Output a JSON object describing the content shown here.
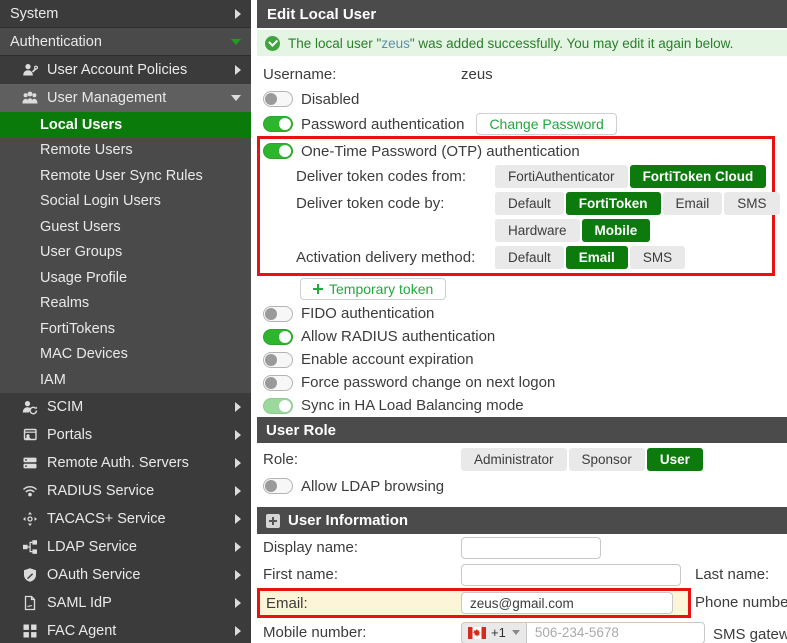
{
  "colors": {
    "accent_green": "#0d7a0d",
    "nav_selected_green": "#0a7a0a",
    "toggle_on_green": "#2eb52e",
    "toggle_muted_green": "#9bd89b",
    "annotation_red": "#e81212",
    "banner_bg": "#e4f5e4",
    "banner_text": "#2c7d2c",
    "banner_username": "#5f8da9",
    "email_row_highlight": "#fdf5d8",
    "sidebar_bg": "#3b3b3b",
    "section_bar_bg": "#4b4b4b"
  },
  "icons": {
    "check-circle-icon": "green circle with white check",
    "plus-icon": "+",
    "chevron-right-icon": "▶",
    "chevron-down-icon": "▼",
    "canada-flag-icon": "red-white-red flag with maple leaf"
  },
  "sidebar": {
    "items": [
      {
        "label": "System"
      },
      {
        "label": "Authentication"
      },
      {
        "label": "User Account Policies"
      },
      {
        "label": "User Management"
      },
      {
        "label": "Local Users"
      },
      {
        "label": "Remote Users"
      },
      {
        "label": "Remote User Sync Rules"
      },
      {
        "label": "Social Login Users"
      },
      {
        "label": "Guest Users"
      },
      {
        "label": "User Groups"
      },
      {
        "label": "Usage Profile"
      },
      {
        "label": "Realms"
      },
      {
        "label": "FortiTokens"
      },
      {
        "label": "MAC Devices"
      },
      {
        "label": "IAM"
      },
      {
        "label": "SCIM"
      },
      {
        "label": "Portals"
      },
      {
        "label": "Remote Auth. Servers"
      },
      {
        "label": "RADIUS Service"
      },
      {
        "label": "TACACS+ Service"
      },
      {
        "label": "LDAP Service"
      },
      {
        "label": "OAuth Service"
      },
      {
        "label": "SAML IdP"
      },
      {
        "label": "FAC Agent"
      }
    ]
  },
  "main": {
    "title": "Edit Local User",
    "banner": {
      "prefix": "The local user \"",
      "username": "zeus",
      "suffix": "\" was added successfully. You may edit it again below."
    },
    "username": {
      "label": "Username:",
      "value": "zeus"
    },
    "disabled": {
      "label": "Disabled",
      "state": "off"
    },
    "password": {
      "label": "Password authentication",
      "state": "on",
      "button": "Change Password"
    },
    "otp": {
      "label": "One-Time Password (OTP) authentication",
      "state": "on",
      "deliver_from": {
        "label": "Deliver token codes from:",
        "options": [
          "FortiAuthenticator",
          "FortiToken Cloud"
        ],
        "selected": "FortiToken Cloud"
      },
      "deliver_by": {
        "label": "Deliver token code by:",
        "options": [
          "Default",
          "FortiToken",
          "Email",
          "SMS"
        ],
        "selected": "FortiToken"
      },
      "token_type": {
        "options": [
          "Hardware",
          "Mobile"
        ],
        "selected": "Mobile"
      },
      "activation": {
        "label": "Activation delivery method:",
        "options": [
          "Default",
          "Email",
          "SMS"
        ],
        "selected": "Email"
      }
    },
    "temporary_token": {
      "label": "Temporary token"
    },
    "toggles": [
      {
        "label": "FIDO authentication",
        "state": "off"
      },
      {
        "label": "Allow RADIUS authentication",
        "state": "on"
      },
      {
        "label": "Enable account expiration",
        "state": "off"
      },
      {
        "label": "Force password change on next logon",
        "state": "off"
      },
      {
        "label": "Sync in HA Load Balancing mode",
        "state": "on_muted"
      }
    ],
    "user_role": {
      "title": "User Role",
      "role_label": "Role:",
      "options": [
        "Administrator",
        "Sponsor",
        "User"
      ],
      "selected": "User",
      "ldap_label": "Allow LDAP browsing",
      "ldap_state": "off"
    },
    "user_info": {
      "title": "User Information",
      "display_name_label": "Display name:",
      "first_name_label": "First name:",
      "last_name_label": "Last name:",
      "email_label": "Email:",
      "email_value": "zeus@gmail.com",
      "phone_label": "Phone number:",
      "mobile_label": "Mobile number:",
      "country_code": "+1",
      "mobile_placeholder": "506-234-5678",
      "sms_label": "SMS gateway:"
    }
  }
}
